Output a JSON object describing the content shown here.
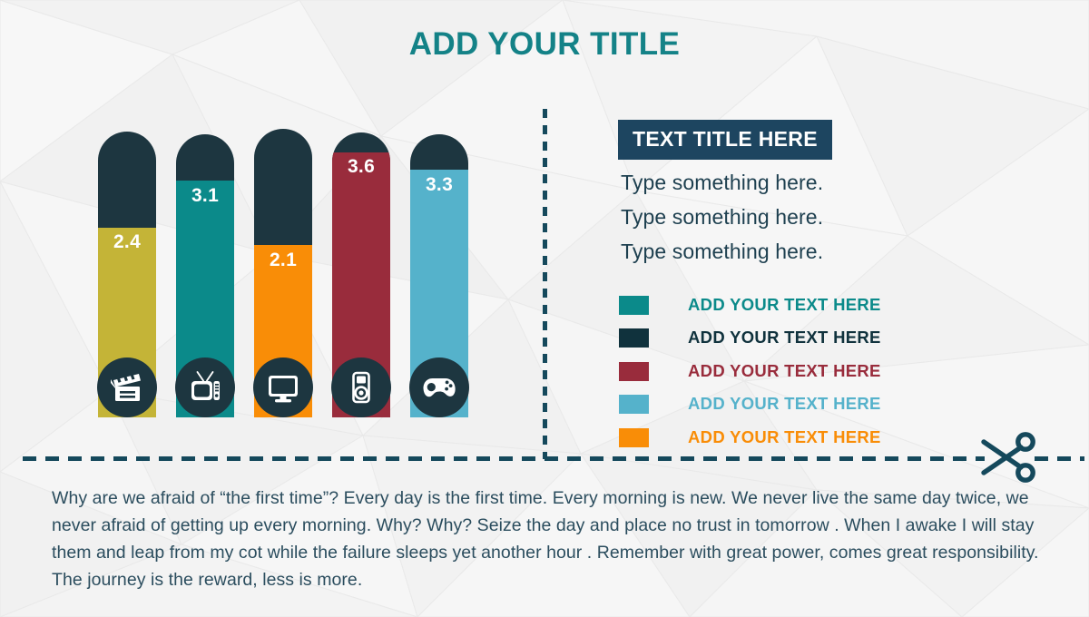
{
  "title": "ADD YOUR TITLE",
  "theme": {
    "title_color": "#148287",
    "dark": "#1d3640",
    "navy_box": "#1d4560",
    "dash_color": "#15495c",
    "body_text": "#2b4d5e",
    "value_text": "#ffffff",
    "background": "#f2f2f2"
  },
  "chart_data": {
    "type": "bar",
    "title": "ADD YOUR TITLE",
    "xlabel": "",
    "ylabel": "",
    "categories": [
      "movie",
      "tv",
      "monitor",
      "mp3-player",
      "gamepad"
    ],
    "values": [
      2.4,
      3.1,
      2.1,
      3.6,
      3.3
    ],
    "value_labels": [
      "2.4",
      "3.1",
      "2.1",
      "3.6",
      "3.3"
    ],
    "colors": [
      "#c4b437",
      "#0b8a8a",
      "#f98d07",
      "#992c3c",
      "#55b2cb"
    ],
    "track_color": "#1d3640",
    "ylim": [
      0,
      4.2
    ],
    "grid": false,
    "legend": "right",
    "note": "Each rounded-top capsule is a track (dark) filled from the bottom to the value; icons sit in dark circles at the base."
  },
  "bars": [
    {
      "icon": "movie-clapper-icon",
      "value": "2.4",
      "color": "#c4b437"
    },
    {
      "icon": "tv-icon",
      "value": "3.1",
      "color": "#0b8a8a"
    },
    {
      "icon": "monitor-icon",
      "value": "2.1",
      "color": "#f98d07"
    },
    {
      "icon": "mp3-player-icon",
      "value": "3.6",
      "color": "#992c3c"
    },
    {
      "icon": "gamepad-icon",
      "value": "3.3",
      "color": "#55b2cb"
    }
  ],
  "panel": {
    "text_title": "TEXT TITLE HERE",
    "lines": [
      "Type something here.",
      "Type something here.",
      "Type something here."
    ],
    "legend": [
      {
        "label": "ADD YOUR TEXT HERE",
        "color": "#0b8a8a"
      },
      {
        "label": "ADD YOUR TEXT HERE",
        "color": "#10323d"
      },
      {
        "label": "ADD YOUR TEXT HERE",
        "color": "#992c3c"
      },
      {
        "label": "ADD YOUR TEXT HERE",
        "color": "#55b2cb"
      },
      {
        "label": "ADD YOUR TEXT HERE",
        "color": "#f98d07"
      }
    ]
  },
  "footer": {
    "paragraph": "Why are we afraid of “the first time”? Every day is the first time. Every morning is new. We never live the same day twice, we never afraid of getting up every morning. Why? Why? Seize the day and place no trust in tomorrow . When I awake I will stay them and leap from my cot while the failure sleeps yet another hour . Remember with great power, comes great responsibility. The journey is the reward, less is more.",
    "cut_icon": "scissors-icon"
  }
}
